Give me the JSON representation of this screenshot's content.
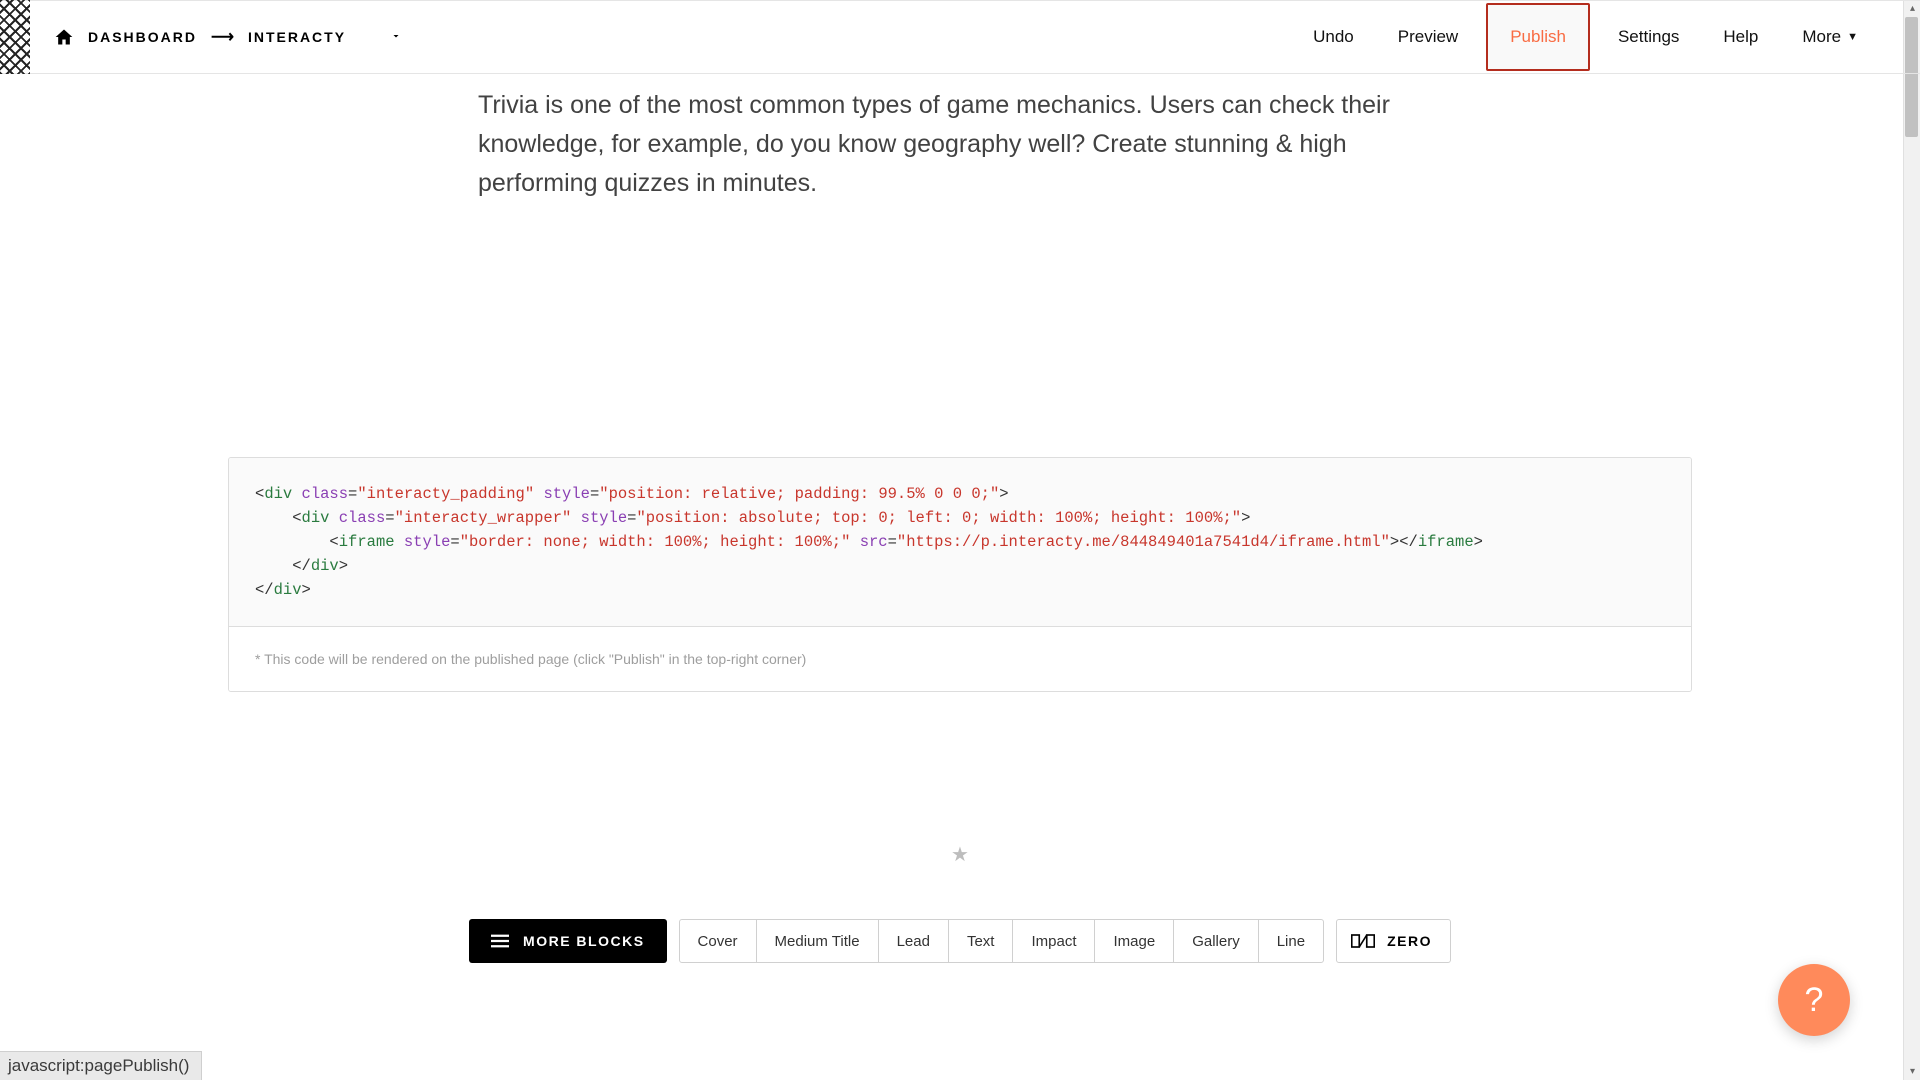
{
  "breadcrumb": {
    "dashboard": "DASHBOARD",
    "project": "INTERACTY"
  },
  "topbar": {
    "undo": "Undo",
    "preview": "Preview",
    "publish": "Publish",
    "settings": "Settings",
    "help": "Help",
    "more": "More"
  },
  "description": "Trivia is one of the most common types of game mechanics. Users can check their knowledge, for example, do you know geography well? Create stunning & high performing quizzes in minutes.",
  "code": {
    "class1": "interacty_padding",
    "style1": "position: relative; padding: 99.5% 0 0 0;",
    "class2": "interacty_wrapper",
    "style2": "position: absolute; top: 0; left: 0; width: 100%; height: 100%;",
    "style3": "border: none; width: 100%; height: 100%;",
    "src": "https://p.interacty.me/844849401a7541d4/iframe.html",
    "note": "* This code will be rendered on the published page (click \"Publish\" in the top-right corner)"
  },
  "blocks": {
    "more": "MORE BLOCKS",
    "items": [
      "Cover",
      "Medium Title",
      "Lead",
      "Text",
      "Impact",
      "Image",
      "Gallery",
      "Line"
    ],
    "zero": "ZERO"
  },
  "help_fab": "?",
  "statusbar": "javascript:pagePublish()"
}
